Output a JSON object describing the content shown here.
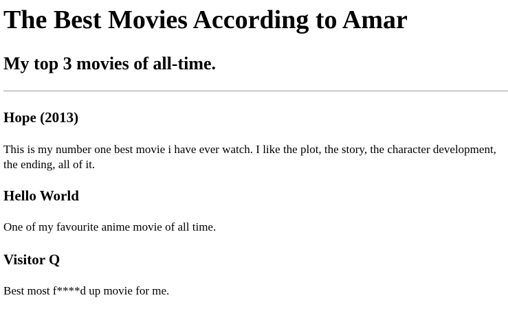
{
  "page": {
    "heading": "The Best Movies According to Amar",
    "subheading": "My top 3 movies of all-time."
  },
  "movies": [
    {
      "title": "Hope (2013)",
      "description": "This is my number one best movie i have ever watch. I like the plot, the story, the character development, the ending, all of it."
    },
    {
      "title": "Hello World",
      "description": "One of my favourite anime movie of all time."
    },
    {
      "title": "Visitor Q",
      "description": "Best most f****d up movie for me."
    }
  ]
}
